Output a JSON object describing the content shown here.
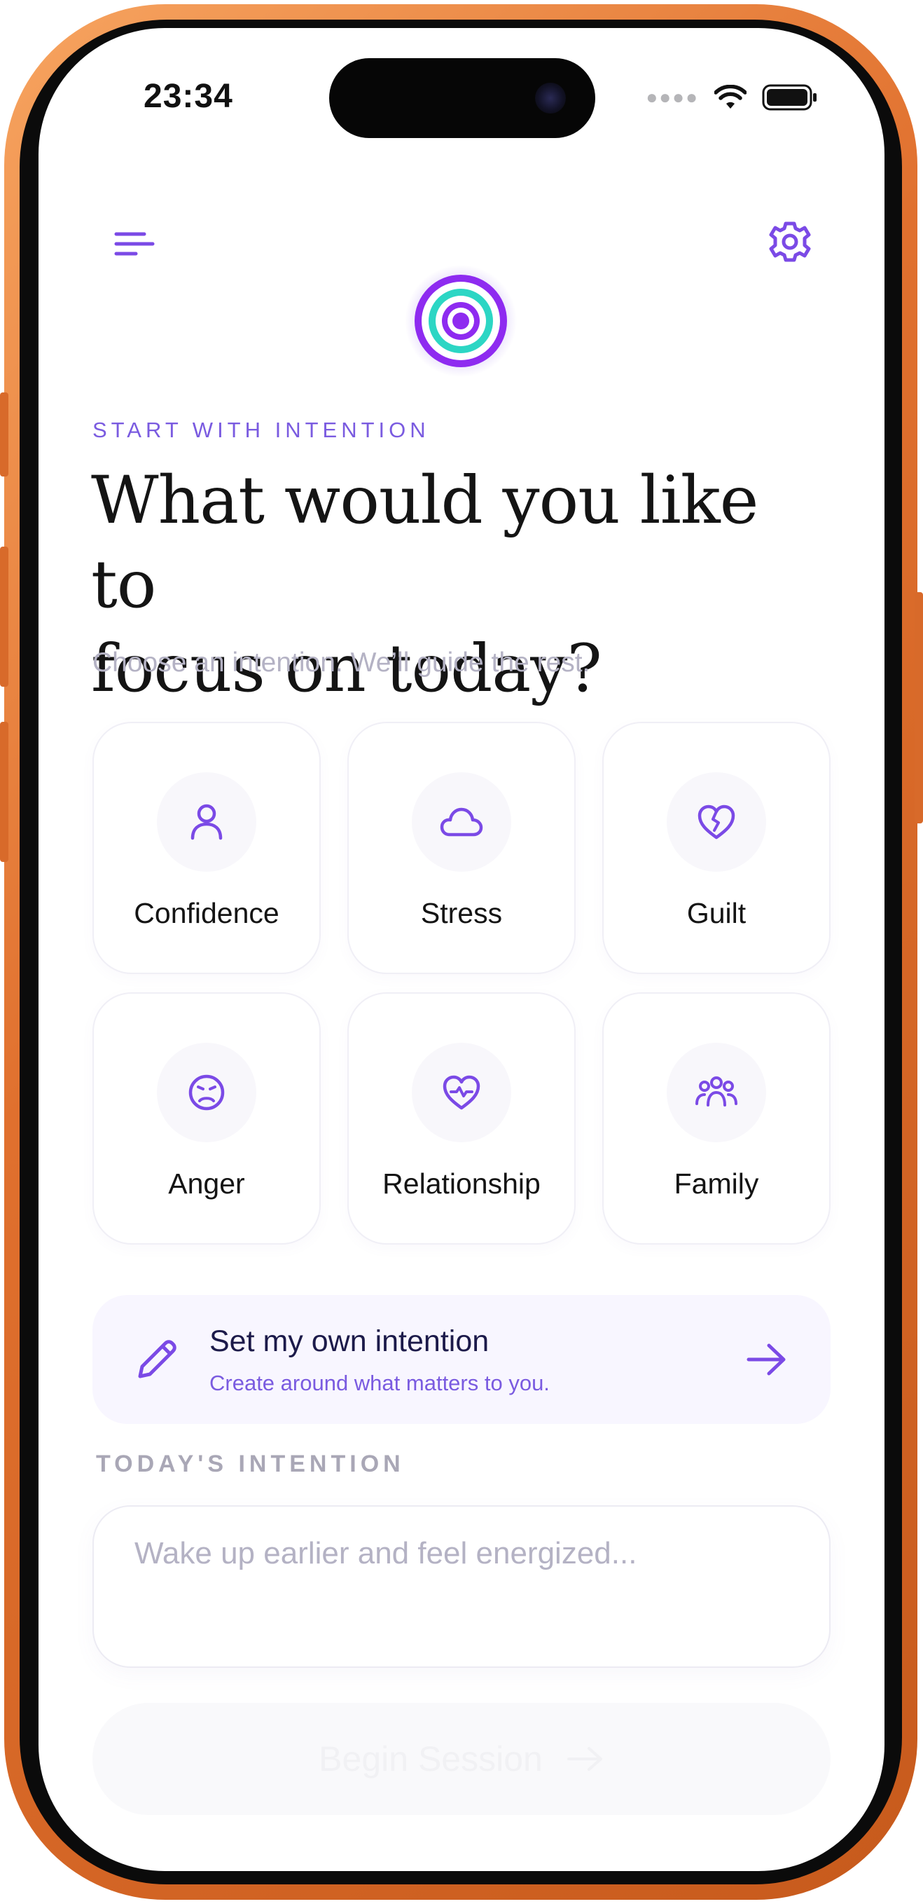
{
  "status_bar": {
    "time": "23:34"
  },
  "header": {
    "eyebrow": "START WITH INTENTION",
    "headline_line1": "What would you like to",
    "headline_line2": "focus on today?",
    "subhead": "Choose an intention. We’ll guide the rest."
  },
  "intentions": [
    {
      "label": "Confidence",
      "icon": "person-icon"
    },
    {
      "label": "Stress",
      "icon": "cloud-icon"
    },
    {
      "label": "Guilt",
      "icon": "broken-heart-icon"
    },
    {
      "label": "Anger",
      "icon": "angry-face-icon"
    },
    {
      "label": "Relationship",
      "icon": "heart-pulse-icon"
    },
    {
      "label": "Family",
      "icon": "group-icon"
    }
  ],
  "own_intention": {
    "title": "Set my own intention",
    "subtitle": "Create around what matters to you."
  },
  "today": {
    "label": "TODAY'S INTENTION",
    "placeholder": "Wake up earlier and feel energized..."
  },
  "begin_button": {
    "label": "Begin Session"
  },
  "colors": {
    "accent": "#7B4AE6",
    "accent_light": "#F8F6FF",
    "teal": "#2CD6C4",
    "frame": "#E0702E"
  }
}
